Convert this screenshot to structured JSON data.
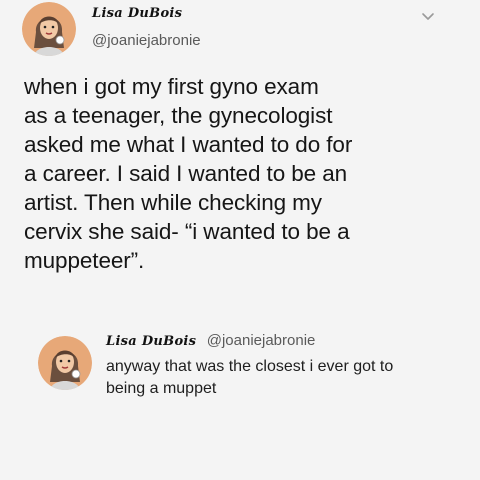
{
  "tweet": {
    "author_name": "Lisa DuBois",
    "author_handle": "@joaniejabronie",
    "body_lines": [
      "when i got my first gyno exam",
      "as a teenager, the gynecologist",
      "asked me what I wanted to do for",
      "a career. I said I wanted to be an",
      "artist. Then while checking my",
      "cervix she said- “i wanted to be a",
      "muppeteer”."
    ],
    "menu_icon": "chevron-down-icon"
  },
  "reply": {
    "author_name": "Lisa DuBois",
    "author_handle": "@joaniejabronie",
    "body_lines": [
      "anyway that was the closest i ever got to",
      "being a muppet"
    ]
  },
  "colors": {
    "background": "#f4f4f4",
    "text": "#161616",
    "handle": "#5a5a5a",
    "avatar_bg": "#e7a878",
    "hair": "#6b4f3e"
  }
}
